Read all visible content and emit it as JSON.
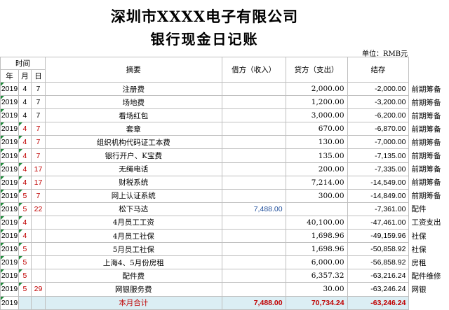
{
  "header": {
    "company": "深圳市XXXX电子有限公司",
    "subtitle": "银行现金日记账",
    "unit": "单位：RMB元"
  },
  "columns": {
    "time": "时间",
    "year": "年",
    "month": "月",
    "day": "日",
    "summary": "摘要",
    "debit": "借方（收入）",
    "credit": "贷方（支出）",
    "balance": "结存"
  },
  "rows": [
    {
      "year": "2019",
      "month": "4",
      "day": "7",
      "summary": "注册费",
      "debit": "",
      "credit": "2,000.00",
      "balance": "-2,000.00",
      "note": "前期筹备",
      "red": false
    },
    {
      "year": "2019",
      "month": "4",
      "day": "7",
      "summary": "场地费",
      "debit": "",
      "credit": "1,200.00",
      "balance": "-3,200.00",
      "note": "前期筹备",
      "red": false
    },
    {
      "year": "2019",
      "month": "4",
      "day": "7",
      "summary": "看场红包",
      "debit": "",
      "credit": "3,000.00",
      "balance": "-6,200.00",
      "note": "前期筹备",
      "red": false
    },
    {
      "year": "2019",
      "month": "4",
      "day": "7",
      "summary": "套章",
      "debit": "",
      "credit": "670.00",
      "balance": "-6,870.00",
      "note": "前期筹备",
      "red": true
    },
    {
      "year": "2019",
      "month": "4",
      "day": "7",
      "summary": "组织机构代码证工本费",
      "debit": "",
      "credit": "130.00",
      "balance": "-7,000.00",
      "note": "前期筹备",
      "red": true
    },
    {
      "year": "2019",
      "month": "4",
      "day": "7",
      "summary": "银行开户、K宝费",
      "debit": "",
      "credit": "135.00",
      "balance": "-7,135.00",
      "note": "前期筹备",
      "red": true
    },
    {
      "year": "2019",
      "month": "4",
      "day": "17",
      "summary": "无绳电话",
      "debit": "",
      "credit": "200.00",
      "balance": "-7,335.00",
      "note": "前期筹备",
      "red": true
    },
    {
      "year": "2019",
      "month": "4",
      "day": "17",
      "summary": "财税系统",
      "debit": "",
      "credit": "7,214.00",
      "balance": "-14,549.00",
      "note": "前期筹备",
      "red": true
    },
    {
      "year": "2019",
      "month": "5",
      "day": "7",
      "summary": "网上认证系统",
      "debit": "",
      "credit": "300.00",
      "balance": "-14,849.00",
      "note": "前期筹备",
      "red": true
    },
    {
      "year": "2019",
      "month": "5",
      "day": "22",
      "summary": "松下马达",
      "debit": "7,488.00",
      "credit": "",
      "balance": "-7,361.00",
      "note": "配件",
      "red": true
    },
    {
      "year": "2019",
      "month": "4",
      "day": "",
      "summary": "4月员工工资",
      "debit": "",
      "credit": "40,100.00",
      "balance": "-47,461.00",
      "note": "工资支出",
      "red": true
    },
    {
      "year": "2019",
      "month": "4",
      "day": "",
      "summary": "4月员工社保",
      "debit": "",
      "credit": "1,698.96",
      "balance": "-49,159.96",
      "note": "社保",
      "red": true
    },
    {
      "year": "2019",
      "month": "5",
      "day": "",
      "summary": "5月员工社保",
      "debit": "",
      "credit": "1,698.96",
      "balance": "-50,858.92",
      "note": "社保",
      "red": true
    },
    {
      "year": "2019",
      "month": "5",
      "day": "",
      "summary": "上海4、5月份房租",
      "debit": "",
      "credit": "6,000.00",
      "balance": "-56,858.92",
      "note": "房租",
      "red": true
    },
    {
      "year": "2019",
      "month": "5",
      "day": "",
      "summary": "配件费",
      "debit": "",
      "credit": "6,357.32",
      "balance": "-63,216.24",
      "note": "配件维修",
      "red": true
    },
    {
      "year": "2019",
      "month": "5",
      "day": "29",
      "summary": "网银服务费",
      "debit": "",
      "credit": "30.00",
      "balance": "-63,246.24",
      "note": "网银",
      "red": true
    }
  ],
  "total": {
    "year": "2019",
    "label": "本月合计",
    "debit": "7,488.00",
    "credit": "70,734.24",
    "balance": "-63,246.24"
  },
  "colors": {
    "red": "#c00000",
    "blue": "#1f4e9b",
    "total_fill": "#dbeef4",
    "marker_green": "#1e8a3a"
  }
}
